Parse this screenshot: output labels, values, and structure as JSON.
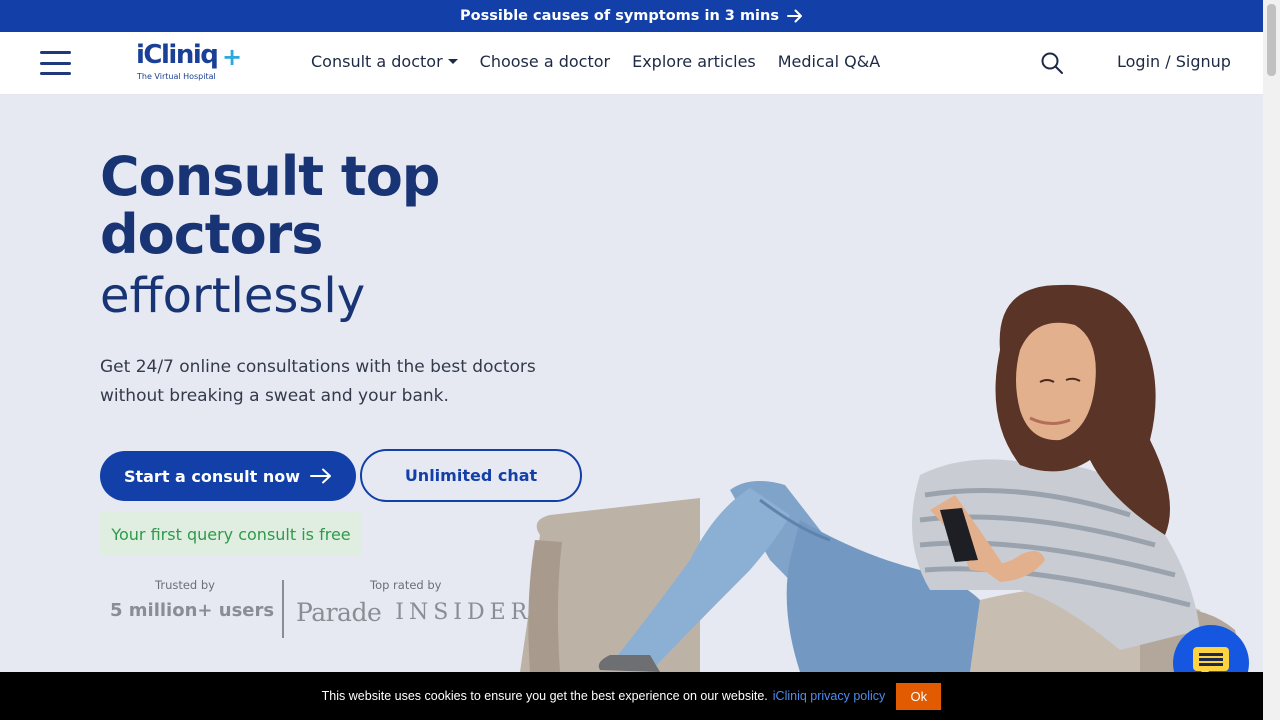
{
  "promo": {
    "text": "Possible causes of symptoms in 3 mins"
  },
  "header": {
    "logo_text": "iCliniq",
    "logo_plus": "+",
    "logo_tagline": "The Virtual Hospital",
    "nav": [
      {
        "label": "Consult a doctor",
        "has_dropdown": true
      },
      {
        "label": "Choose a doctor"
      },
      {
        "label": "Explore articles"
      },
      {
        "label": "Medical Q&A"
      }
    ],
    "login_label": "Login / Signup"
  },
  "hero": {
    "title_line1": "Consult top",
    "title_line2": "doctors",
    "subtitle": "effortlessly",
    "description": "Get 24/7 online consultations with the best doctors without breaking a sweat and your bank.",
    "primary_button": "Start a consult now",
    "secondary_button": "Unlimited chat",
    "free_note": "Your first query consult is free"
  },
  "trust": {
    "trusted_by_label": "Trusted by",
    "users": "5 million+ users",
    "top_rated_label": "Top rated by",
    "publications": [
      "Parade",
      "INSIDER"
    ]
  },
  "cookie": {
    "text": "This website uses cookies to ensure you get the best experience on our website.",
    "link_text": "iCliniq privacy policy",
    "ok_label": "Ok"
  },
  "colors": {
    "brand_blue": "#1240a8",
    "heading_navy": "#183475",
    "page_bg": "#e6e9f2",
    "free_green": "#2e9a4a",
    "cookie_ok": "#e35b00",
    "chat_fab": "#1557e0"
  },
  "icons": [
    "arrow-right-icon",
    "hamburger-menu-icon",
    "search-icon",
    "chat-icon"
  ]
}
